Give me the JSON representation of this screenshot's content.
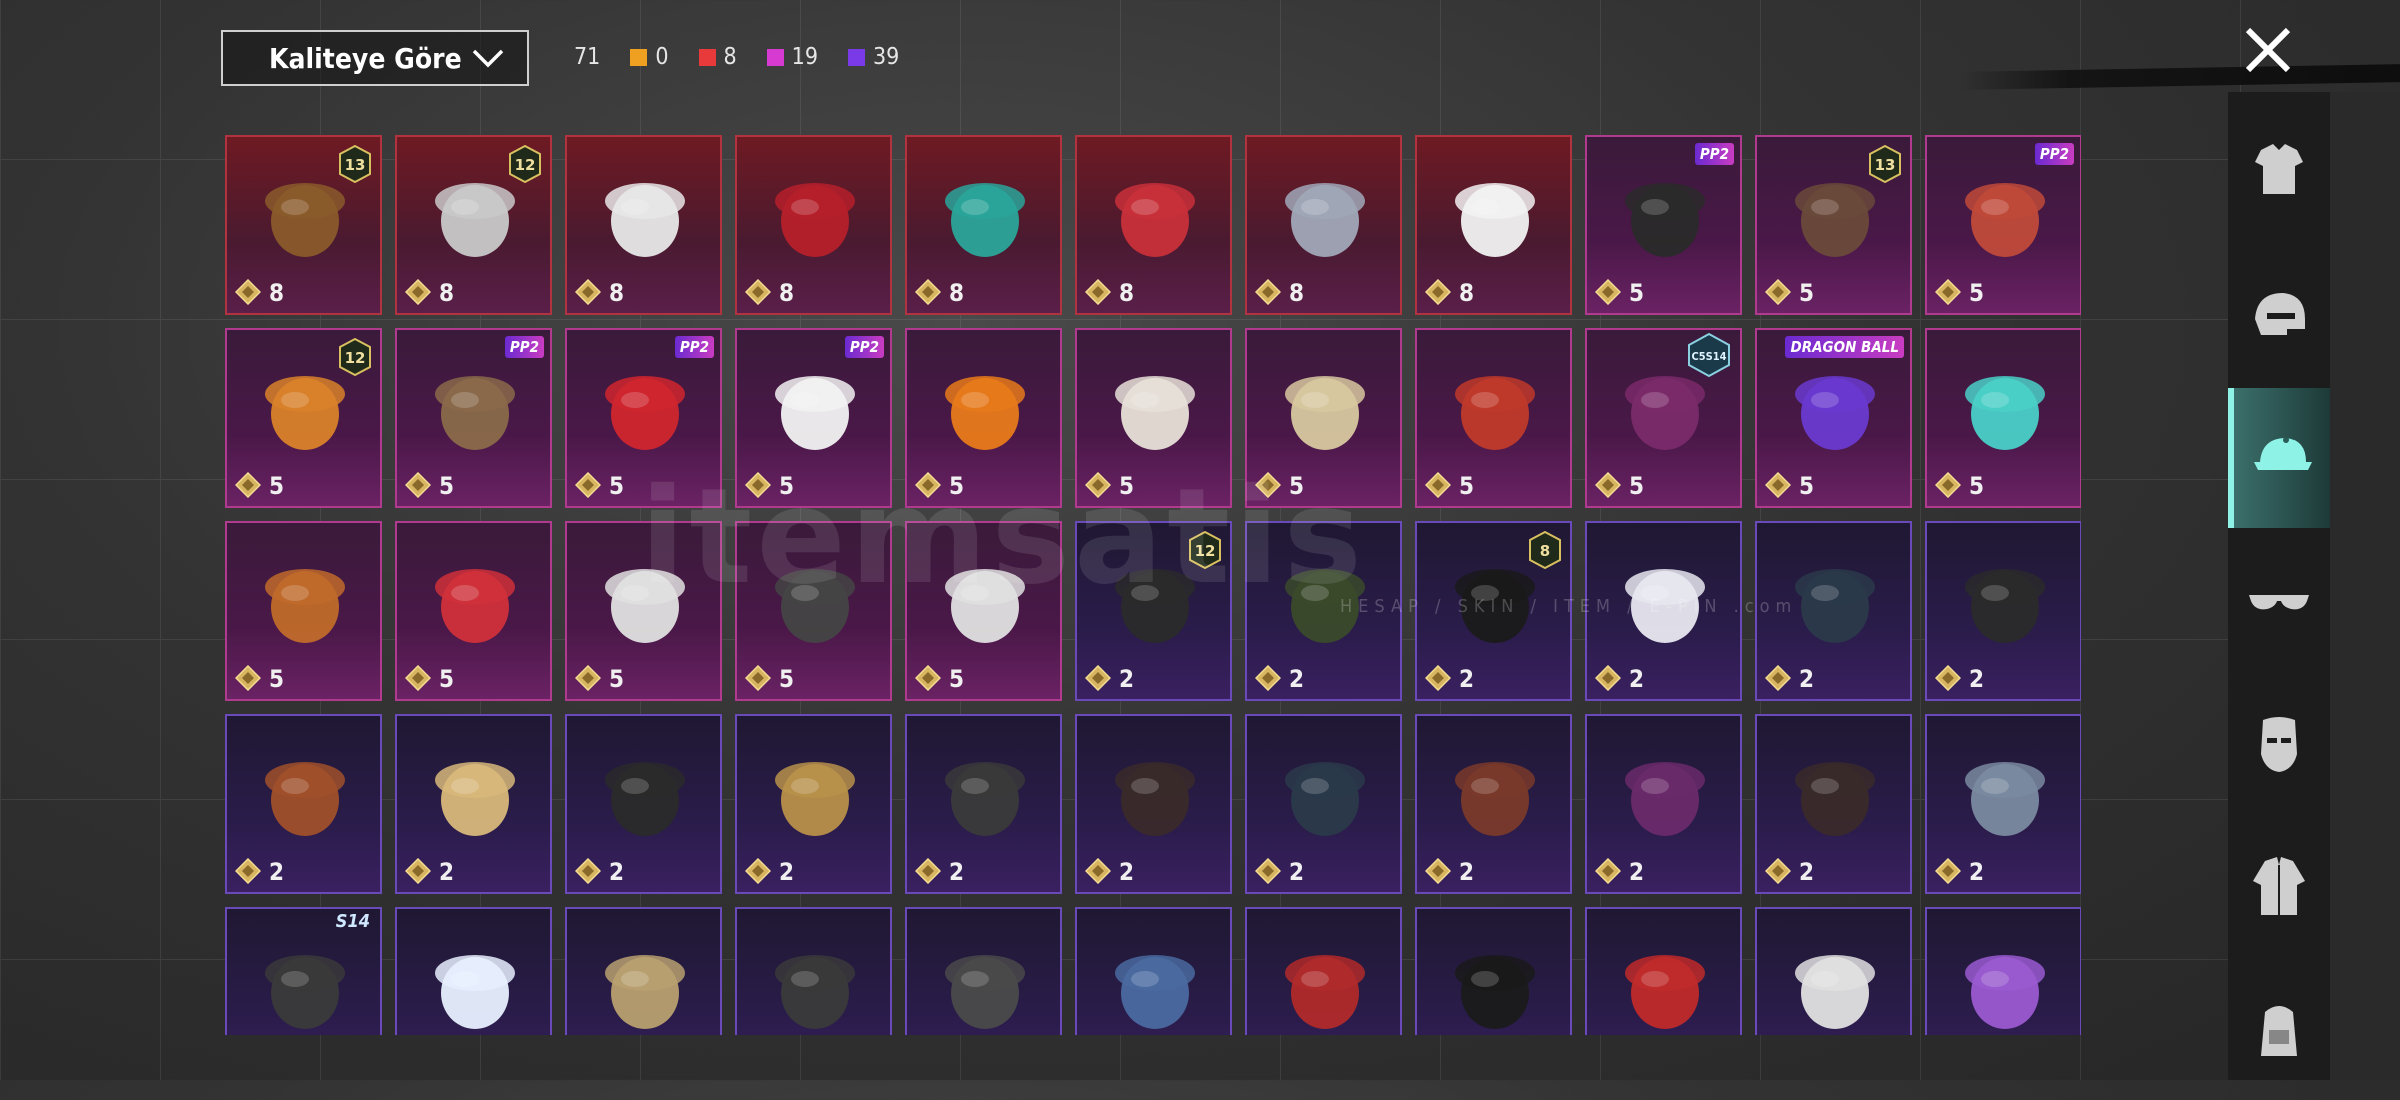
{
  "sort": {
    "label": "Kaliteye Göre"
  },
  "counts": {
    "total": "71",
    "items": [
      {
        "color": "#f0a020",
        "value": "0"
      },
      {
        "color": "#e83a3a",
        "value": "8"
      },
      {
        "color": "#d63ad0",
        "value": "19"
      },
      {
        "color": "#7a3ae8",
        "value": "39"
      }
    ]
  },
  "watermark": {
    "main": "itemsatis",
    "sub": "HESAP / SKIN / ITEM / E-PIN .com"
  },
  "sidebar": {
    "categories": [
      {
        "name": "outfit-icon"
      },
      {
        "name": "helmet-icon"
      },
      {
        "name": "hat-icon",
        "active": true
      },
      {
        "name": "glasses-icon"
      },
      {
        "name": "mask-icon"
      },
      {
        "name": "jacket-icon"
      },
      {
        "name": "backpack-icon"
      }
    ]
  },
  "grid": {
    "rows": [
      [
        {
          "quality": "red",
          "price": "8",
          "badge": "13",
          "art": "feather-hat"
        },
        {
          "quality": "red",
          "price": "8",
          "badge": "12",
          "art": "silver-hair"
        },
        {
          "quality": "red",
          "price": "8",
          "art": "white-hat"
        },
        {
          "quality": "red",
          "price": "8",
          "art": "red-helmet"
        },
        {
          "quality": "red",
          "price": "8",
          "art": "jade-mask"
        },
        {
          "quality": "red",
          "price": "8",
          "art": "oni-mask"
        },
        {
          "quality": "red",
          "price": "8",
          "art": "knight-helm"
        },
        {
          "quality": "red",
          "price": "8",
          "art": "ghost"
        },
        {
          "quality": "pink",
          "price": "5",
          "tag": "PP2",
          "art": "dark-hair"
        },
        {
          "quality": "pink",
          "price": "5",
          "badge": "13",
          "art": "aviator"
        },
        {
          "quality": "pink",
          "price": "5",
          "tag": "PP2",
          "art": "glasses-cap"
        }
      ],
      [
        {
          "quality": "pink",
          "price": "5",
          "badge": "12",
          "art": "orange-hair"
        },
        {
          "quality": "pink",
          "price": "5",
          "tag": "PP2",
          "art": "cow-head"
        },
        {
          "quality": "pink",
          "price": "5",
          "tag": "PP2",
          "art": "red-hair"
        },
        {
          "quality": "pink",
          "price": "5",
          "tag": "PP2",
          "art": "panda"
        },
        {
          "quality": "pink",
          "price": "5",
          "art": "pumpkin"
        },
        {
          "quality": "pink",
          "price": "5",
          "art": "lion-dance"
        },
        {
          "quality": "pink",
          "price": "5",
          "art": "blonde-braids"
        },
        {
          "quality": "pink",
          "price": "5",
          "art": "dragon-mask"
        },
        {
          "quality": "pink",
          "price": "5",
          "hex": "C5S14",
          "art": "purple-hair"
        },
        {
          "quality": "pink",
          "price": "5",
          "tag": "DRAGON BALL",
          "art": "purple-helmet"
        },
        {
          "quality": "pink",
          "price": "5",
          "art": "cyan-mohawk"
        }
      ],
      [
        {
          "quality": "pink",
          "price": "5",
          "art": "dino-head"
        },
        {
          "quality": "pink",
          "price": "5",
          "art": "red-wig"
        },
        {
          "quality": "pink",
          "price": "5",
          "art": "dreadlocks"
        },
        {
          "quality": "pink",
          "price": "5",
          "art": "dark-shades"
        },
        {
          "quality": "pink",
          "price": "5",
          "art": "skull-mask"
        },
        {
          "quality": "purple",
          "price": "2",
          "badge": "12",
          "art": "bunny-helmet"
        },
        {
          "quality": "purple",
          "price": "2",
          "art": "officer-cap"
        },
        {
          "quality": "purple",
          "price": "2",
          "badge": "8",
          "art": "green-skull"
        },
        {
          "quality": "purple",
          "price": "2",
          "art": "white-cap"
        },
        {
          "quality": "purple",
          "price": "2",
          "art": "gas-helmet"
        },
        {
          "quality": "purple",
          "price": "2",
          "art": "black-helmet"
        }
      ],
      [
        {
          "quality": "purple",
          "price": "2",
          "art": "goggles-hair"
        },
        {
          "quality": "purple",
          "price": "2",
          "art": "pith-helmet"
        },
        {
          "quality": "purple",
          "price": "2",
          "art": "black-cap"
        },
        {
          "quality": "purple",
          "price": "2",
          "art": "long-blonde"
        },
        {
          "quality": "purple",
          "price": "2",
          "art": "green-cap"
        },
        {
          "quality": "purple",
          "price": "2",
          "art": "steampunk-hat"
        },
        {
          "quality": "purple",
          "price": "2",
          "art": "robot-hair"
        },
        {
          "quality": "purple",
          "price": "2",
          "art": "auburn-hair"
        },
        {
          "quality": "purple",
          "price": "2",
          "art": "witch-hat"
        },
        {
          "quality": "purple",
          "price": "2",
          "art": "bob-hair"
        },
        {
          "quality": "purple",
          "price": "2",
          "art": "grey-cap"
        }
      ],
      [
        {
          "quality": "purple",
          "price": "",
          "season": "S14",
          "art": "spartan"
        },
        {
          "quality": "purple",
          "price": "",
          "art": "bunny-ears"
        },
        {
          "quality": "purple",
          "price": "",
          "art": "straw-hat"
        },
        {
          "quality": "purple",
          "price": "",
          "art": "bowl-helmet"
        },
        {
          "quality": "purple",
          "price": "",
          "art": "luchador"
        },
        {
          "quality": "purple",
          "price": "",
          "art": "shark-hat"
        },
        {
          "quality": "purple",
          "price": "",
          "art": "beret"
        },
        {
          "quality": "purple",
          "price": "",
          "art": "top-hat"
        },
        {
          "quality": "purple",
          "price": "",
          "art": "red-fedora"
        },
        {
          "quality": "purple",
          "price": "",
          "art": "shark-mask"
        },
        {
          "quality": "purple",
          "price": "",
          "art": "flower-crown"
        }
      ]
    ]
  }
}
